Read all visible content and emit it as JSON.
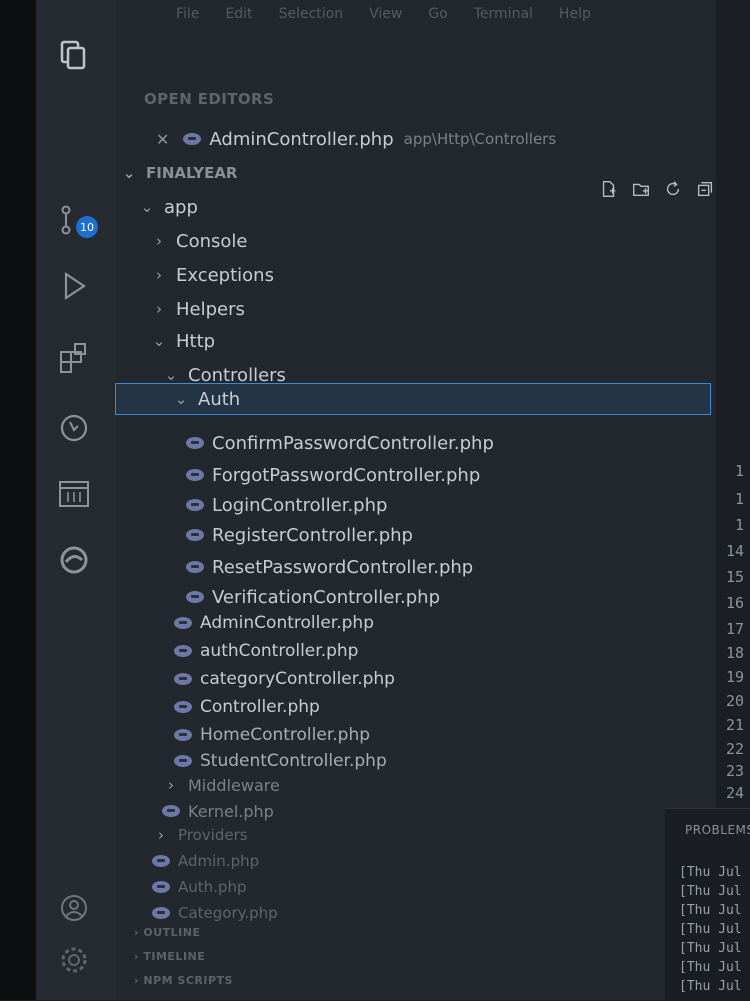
{
  "menu": [
    "File",
    "Edit",
    "Selection",
    "View",
    "Go",
    "Terminal",
    "Help"
  ],
  "activity": {
    "badge_count": "10",
    "icons": [
      "files-icon",
      "search-icon",
      "source-control-icon",
      "run-debug-icon",
      "extensions-icon",
      "git-history-icon",
      "calendar-icon",
      "edge-icon",
      "account-icon",
      "settings-icon"
    ]
  },
  "open_editors": {
    "title": "OPEN EDITORS",
    "items": [
      {
        "name": "AdminController.php",
        "path": "app\\Http\\Controllers"
      }
    ]
  },
  "workspace": {
    "title": "FINALYEAR",
    "tree": [
      {
        "label": "app"
      },
      {
        "label": "Console"
      },
      {
        "label": "Exceptions"
      },
      {
        "label": "Helpers"
      },
      {
        "label": "Http"
      },
      {
        "label": "Controllers"
      },
      {
        "label": "Auth"
      },
      {
        "label": "ConfirmPasswordController.php"
      },
      {
        "label": "ForgotPasswordController.php"
      },
      {
        "label": "LoginController.php"
      },
      {
        "label": "RegisterController.php"
      },
      {
        "label": "ResetPasswordController.php"
      },
      {
        "label": "VerificationController.php"
      },
      {
        "label": "AdminController.php"
      },
      {
        "label": "authController.php"
      },
      {
        "label": "categoryController.php"
      },
      {
        "label": "Controller.php"
      },
      {
        "label": "HomeController.php"
      },
      {
        "label": "StudentController.php"
      },
      {
        "label": "Middleware"
      },
      {
        "label": "Kernel.php"
      },
      {
        "label": "Providers"
      },
      {
        "label": "Admin.php"
      },
      {
        "label": "Auth.php"
      },
      {
        "label": "Category.php"
      }
    ]
  },
  "footer_sections": [
    "OUTLINE",
    "TIMELINE",
    "NPM SCRIPTS"
  ],
  "line_numbers": [
    "1",
    "1",
    "1",
    "14",
    "15",
    "16",
    "17",
    "18",
    "19",
    "20",
    "21",
    "22",
    "23",
    "24"
  ],
  "panel": {
    "title": "PROBLEMS",
    "terminal_lines": [
      "[Thu Jul",
      "[Thu Jul",
      "[Thu Jul",
      "[Thu Jul",
      "[Thu Jul",
      "[Thu Jul",
      "[Thu Jul"
    ]
  },
  "colors": {
    "accent": "#3f86d6",
    "badge": "#1f6fd0",
    "php_icon": "#6c78a8"
  }
}
